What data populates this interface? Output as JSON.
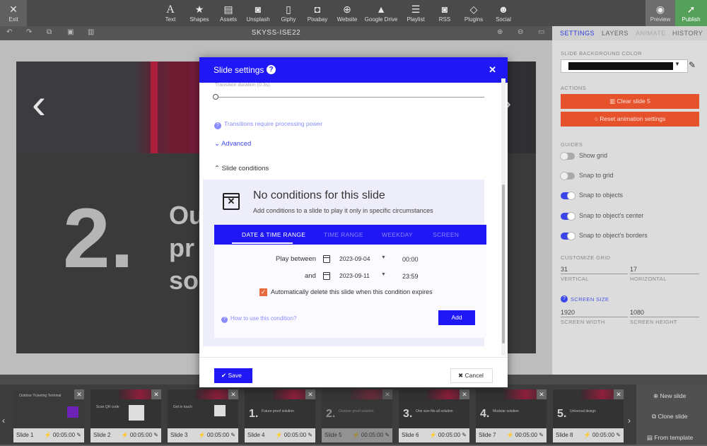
{
  "topbar": {
    "exit": "Exit",
    "tools": [
      {
        "label": "Text",
        "icon": "text-icon",
        "glyph": "A"
      },
      {
        "label": "Shapes",
        "icon": "star-icon",
        "glyph": "★"
      },
      {
        "label": "Assets",
        "icon": "file-icon",
        "glyph": "▤"
      },
      {
        "label": "Unsplash",
        "icon": "camera-icon",
        "glyph": "◙"
      },
      {
        "label": "Giphy",
        "icon": "gif-icon",
        "glyph": "▯"
      },
      {
        "label": "Pixabay",
        "icon": "photo-icon",
        "glyph": "◘"
      },
      {
        "label": "Website",
        "icon": "globe-icon",
        "glyph": "⊕"
      },
      {
        "label": "Google Drive",
        "icon": "drive-icon",
        "glyph": "▲"
      },
      {
        "label": "Playlist",
        "icon": "list-icon",
        "glyph": "☰"
      },
      {
        "label": "RSS",
        "icon": "rss-icon",
        "glyph": "◙"
      },
      {
        "label": "Plugins",
        "icon": "diamond-icon",
        "glyph": "◇"
      },
      {
        "label": "Social",
        "icon": "people-icon",
        "glyph": "☻"
      }
    ],
    "preview": "Preview",
    "publish": "Publish"
  },
  "subbar": {
    "title": "SKYSS-ISE22"
  },
  "slide": {
    "number": "2.",
    "lines": [
      "Ou",
      "pr",
      "so"
    ]
  },
  "right_panel": {
    "tabs": [
      "SETTINGS",
      "LAYERS",
      "ANIMATE",
      "HISTORY"
    ],
    "bg_color_label": "SLIDE BACKGROUND COLOR",
    "bg_color": "#111111",
    "actions_label": "ACTIONS",
    "clear_slide": "Clear slide 5",
    "reset_anim": "Reset animation settings",
    "guides_label": "GUIDES",
    "guides": [
      {
        "label": "Show grid",
        "on": false
      },
      {
        "label": "Snap to grid",
        "on": false
      },
      {
        "label": "Snap to objects",
        "on": true
      },
      {
        "label": "Snap to object's center",
        "on": true
      },
      {
        "label": "Snap to object's borders",
        "on": true
      }
    ],
    "customize_grid_label": "CUSTOMIZE GRID",
    "grid_vertical": "31",
    "grid_vertical_label": "VERTICAL",
    "grid_horizontal": "17",
    "grid_horizontal_label": "HORIZONTAL",
    "screen_size_label": "SCREEN SIZE",
    "screen_width": "1920",
    "screen_width_label": "SCREEN WIDTH",
    "screen_height": "1080",
    "screen_height_label": "SCREEN HEIGHT"
  },
  "filmstrip": {
    "slides": [
      {
        "label": "Slide 1",
        "duration": "00:05:00",
        "num": "",
        "title": "Outdoor Ticketing Terminal"
      },
      {
        "label": "Slide 2",
        "duration": "00:05:00",
        "num": "",
        "title": "Scan QR code"
      },
      {
        "label": "Slide 3",
        "duration": "00:05:00",
        "num": "",
        "title": "Get in touch"
      },
      {
        "label": "Slide 4",
        "duration": "00:05:00",
        "num": "1.",
        "title": "Future proof solution"
      },
      {
        "label": "Slide 5",
        "duration": "00:05:00",
        "num": "2.",
        "title": "Outdoor proof solution"
      },
      {
        "label": "Slide 6",
        "duration": "00:05:00",
        "num": "3.",
        "title": "One size fits all solution"
      },
      {
        "label": "Slide 7",
        "duration": "00:05:00",
        "num": "4.",
        "title": "Modular solution"
      },
      {
        "label": "Slide 8",
        "duration": "00:05:00",
        "num": "5.",
        "title": "Universal design"
      }
    ],
    "new_slide": "New slide",
    "clone_slide": "Clone slide",
    "from_template": "From template"
  },
  "modal": {
    "title": "Slide settings",
    "transition_label": "Transition duration (0.3s)",
    "transition_info": "Transitions require processing power",
    "advanced": "Advanced",
    "slide_conditions": "Slide conditions",
    "no_conditions_title": "No conditions for this slide",
    "no_conditions_sub": "Add conditions to a slide to play it only in specific circumstances",
    "tabs": [
      "DATE & TIME RANGE",
      "TIME RANGE",
      "WEEKDAY",
      "SCREEN"
    ],
    "play_between": "Play between",
    "start_date": "2023-09-04",
    "start_time": "00:00",
    "and": "and",
    "end_date": "2023-09-11",
    "end_time": "23:59",
    "auto_delete": "Automatically delete this slide when this condition expires",
    "how_to": "How to use this condition?",
    "add": "Add",
    "save": "Save",
    "cancel": "Cancel"
  }
}
